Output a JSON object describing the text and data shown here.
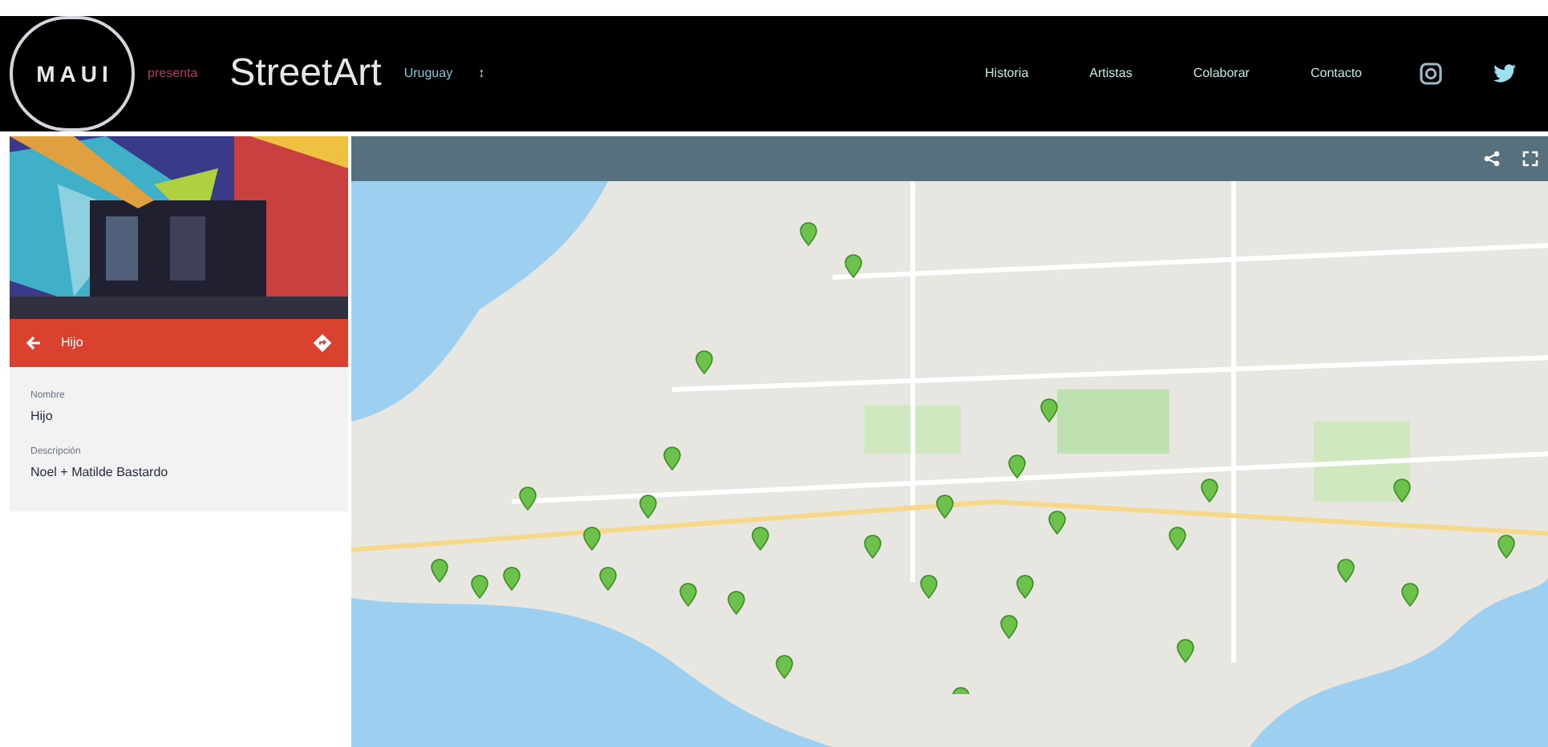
{
  "header": {
    "logo_letters": [
      "M",
      "A",
      "U",
      "I"
    ],
    "tagline": "presenta",
    "title": "StreetArt",
    "region": "Uruguay",
    "region_caret": "↕",
    "nav": [
      {
        "label": "Historia"
      },
      {
        "label": "Artistas"
      },
      {
        "label": "Colaborar"
      },
      {
        "label": "Contacto"
      }
    ]
  },
  "panel": {
    "title": "Hijo",
    "fields": [
      {
        "label": "Nombre",
        "value": "Hijo"
      },
      {
        "label": "Descripción",
        "value": "Noel + Matilde Bastardo"
      }
    ]
  }
}
